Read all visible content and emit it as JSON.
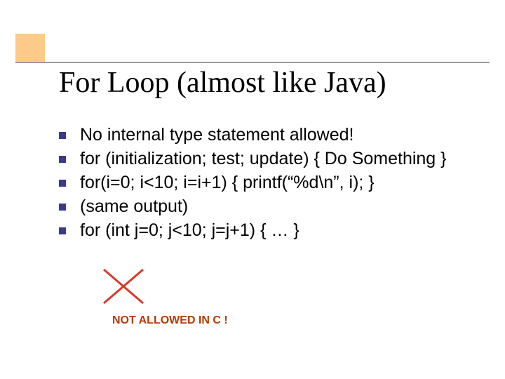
{
  "colors": {
    "accent_box": "#feca88",
    "rule": "#9a9a9a",
    "bullet": "#3a3a8a",
    "cross": "#d63a2a",
    "footer": "#b33a00"
  },
  "title": "For Loop (almost like Java)",
  "bullets": [
    "No internal type statement allowed!",
    "for (initialization; test; update) { Do Something }",
    "for(i=0; i<10; i=i+1) { printf(“%d\\n”, i); }",
    "(same output)",
    "for (int j=0; j<10; j=j+1) { … }"
  ],
  "footer": "NOT ALLOWED IN C !"
}
